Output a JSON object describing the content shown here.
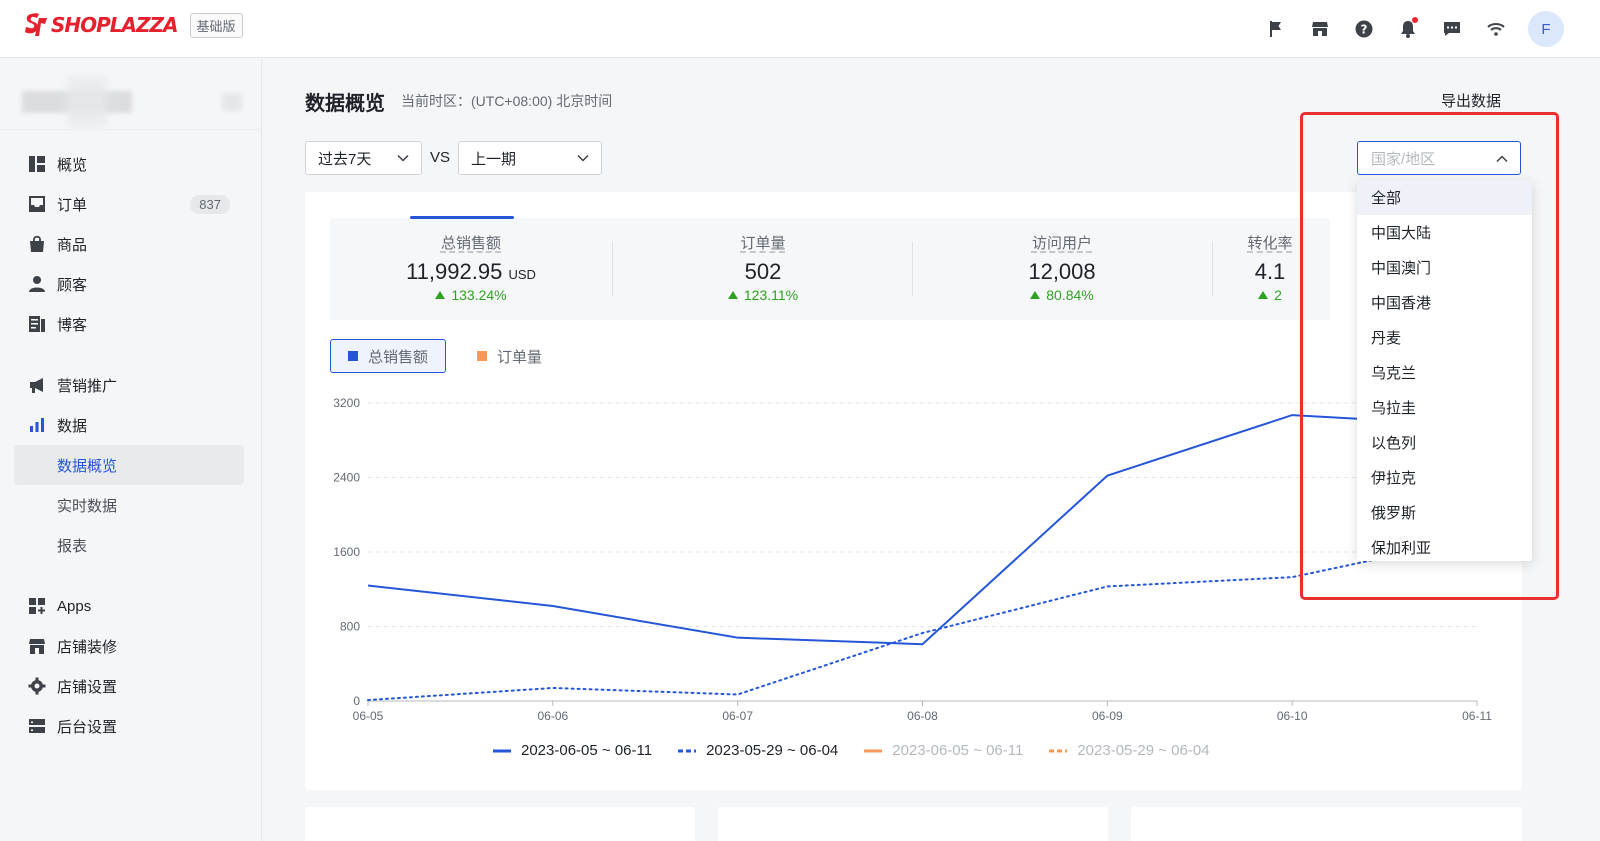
{
  "header": {
    "brand": "SHOPLAZZA",
    "plan_badge": "基础版",
    "avatar_initial": "F",
    "brand_color": "#e5212e",
    "icons": [
      "flag-icon",
      "store-icon",
      "help-icon",
      "bell-icon",
      "message-icon",
      "wifi-icon"
    ]
  },
  "sidebar": {
    "items": [
      {
        "label": "概览",
        "icon": "dashboard-icon"
      },
      {
        "label": "订单",
        "icon": "inbox-icon",
        "count": "837"
      },
      {
        "label": "商品",
        "icon": "bag-icon"
      },
      {
        "label": "顾客",
        "icon": "user-icon"
      },
      {
        "label": "博客",
        "icon": "blog-icon"
      },
      {
        "label": "营销推广",
        "icon": "megaphone-icon"
      },
      {
        "label": "数据",
        "icon": "bar-chart-icon"
      },
      {
        "label": "数据概览",
        "sub": true,
        "active": true
      },
      {
        "label": "实时数据",
        "sub": true
      },
      {
        "label": "报表",
        "sub": true
      },
      {
        "label": "Apps",
        "icon": "apps-icon"
      },
      {
        "label": "店铺装修",
        "icon": "storefront-icon"
      },
      {
        "label": "店铺设置",
        "icon": "gear-icon"
      },
      {
        "label": "后台设置",
        "icon": "server-icon"
      }
    ]
  },
  "page": {
    "title": "数据概览",
    "timezone": "当前时区：(UTC+08:00) 北京时间",
    "export_label": "导出数据",
    "period_select": "过去7天",
    "vs_label": "VS",
    "compare_select": "上一期",
    "region_placeholder": "国家/地区"
  },
  "metrics": [
    {
      "label": "总销售额",
      "value": "11,992.95",
      "unit": "USD",
      "change": "133.24%",
      "active": true
    },
    {
      "label": "订单量",
      "value": "502",
      "change": "123.11%"
    },
    {
      "label": "访问用户",
      "value": "12,008",
      "change": "80.84%"
    },
    {
      "label": "转化率",
      "value": "4.1",
      "change": "2"
    }
  ],
  "toggles": [
    {
      "label": "总销售额",
      "color": "#2456d7",
      "on": true
    },
    {
      "label": "订单量",
      "color": "#f7975a",
      "on": false
    }
  ],
  "chart_data": {
    "type": "line",
    "categories": [
      "06-05",
      "06-06",
      "06-07",
      "06-08",
      "06-09",
      "06-10",
      "06-11"
    ],
    "y_ticks": [
      "0",
      "800",
      "1600",
      "2400",
      "3200"
    ],
    "ylim": [
      0,
      3200
    ],
    "grid": true,
    "series": [
      {
        "name": "2023-06-05 ~ 06-11",
        "style": "solid",
        "color": "#2456d7",
        "values": [
          1240,
          1020,
          680,
          610,
          2420,
          3070,
          2960
        ]
      },
      {
        "name": "2023-05-29 ~ 06-04",
        "style": "dotted",
        "color": "#2456d7",
        "values": [
          10,
          140,
          70,
          730,
          1230,
          1330,
          1750
        ]
      },
      {
        "name": "2023-06-05 ~ 06-11",
        "style": "solid",
        "color": "#f7975a",
        "hidden": true
      },
      {
        "name": "2023-05-29 ~ 06-04",
        "style": "dashed",
        "color": "#f7975a",
        "hidden": true
      }
    ]
  },
  "region_dropdown": {
    "options": [
      "全部",
      "中国大陆",
      "中国澳门",
      "中国香港",
      "丹麦",
      "乌克兰",
      "乌拉圭",
      "以色列",
      "伊拉克",
      "俄罗斯",
      "保加利亚"
    ],
    "highlight_color": "#e8302f"
  }
}
